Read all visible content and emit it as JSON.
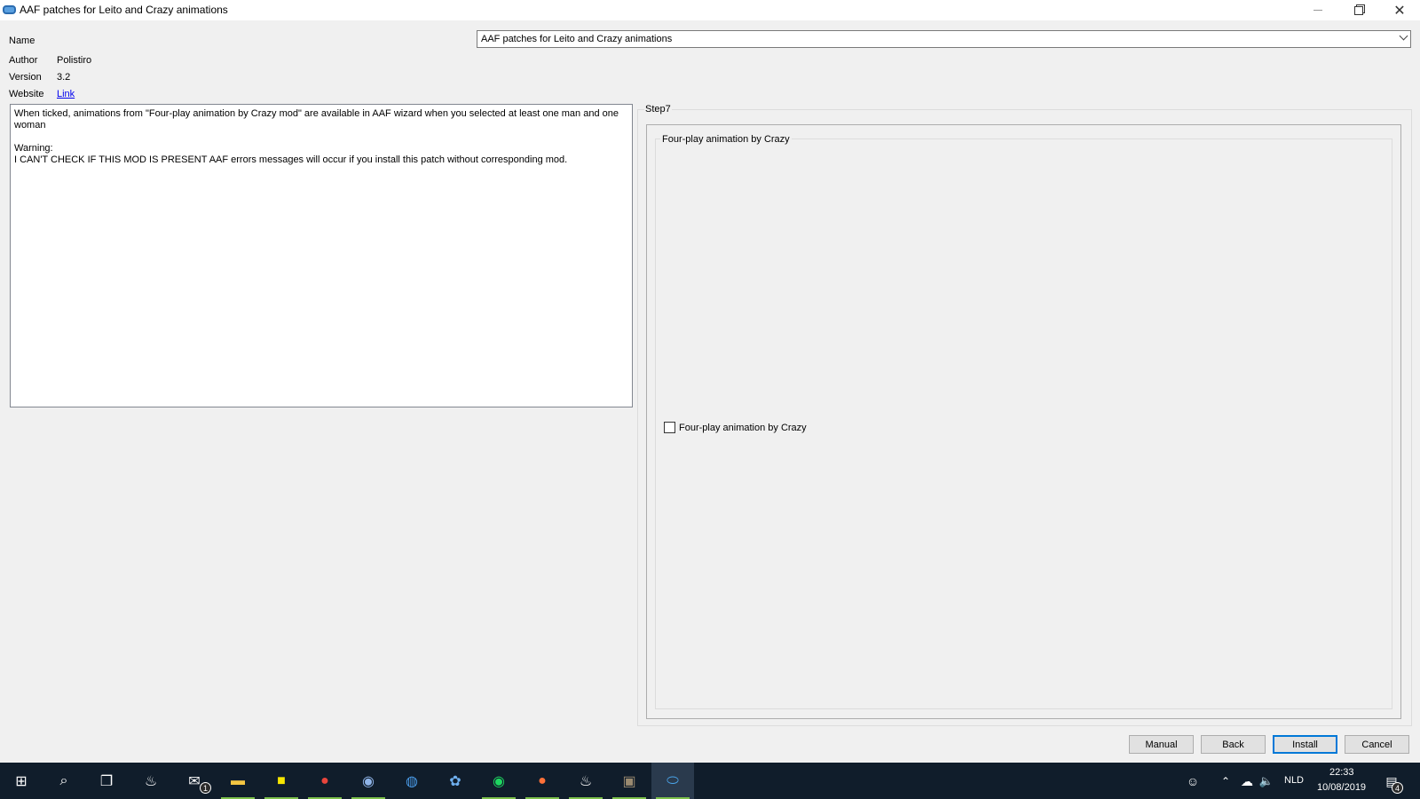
{
  "window": {
    "title": "AAF patches for Leito and Crazy animations"
  },
  "info": {
    "name_label": "Name",
    "author_label": "Author",
    "author_value": "Polistiro",
    "version_label": "Version",
    "version_value": "3.2",
    "website_label": "Website",
    "website_link": "Link"
  },
  "name_select": {
    "selected": "AAF patches for Leito and Crazy animations"
  },
  "description": "When ticked, animations from \"Four-play animation by Crazy mod\" are available in AAF wizard when you selected at least one man and one woman\n\nWarning:\nI CAN'T CHECK IF THIS MOD IS PRESENT AAF errors messages will occur if you install this patch without corresponding mod.",
  "step": {
    "title": "Step7",
    "group_title": "Four-play animation by Crazy",
    "option_label": "Four-play animation by Crazy",
    "option_checked": false
  },
  "buttons": {
    "manual": "Manual",
    "back": "Back",
    "install": "Install",
    "cancel": "Cancel"
  },
  "taskbar": {
    "mail_badge": "1",
    "language": "NLD",
    "time": "22:33",
    "date": "10/08/2019",
    "notification_count": "4",
    "icons": [
      "windows-start-icon",
      "search-icon",
      "task-view-icon",
      "steam-icon",
      "mail-icon",
      "file-explorer-icon",
      "sticky-notes-icon",
      "chrome-icon",
      "chrome-alt-icon",
      "grammarly-icon",
      "app-icon",
      "spotify-icon",
      "firefox-icon",
      "steam-alt-icon",
      "media-app-icon",
      "mod-organizer-icon"
    ]
  }
}
